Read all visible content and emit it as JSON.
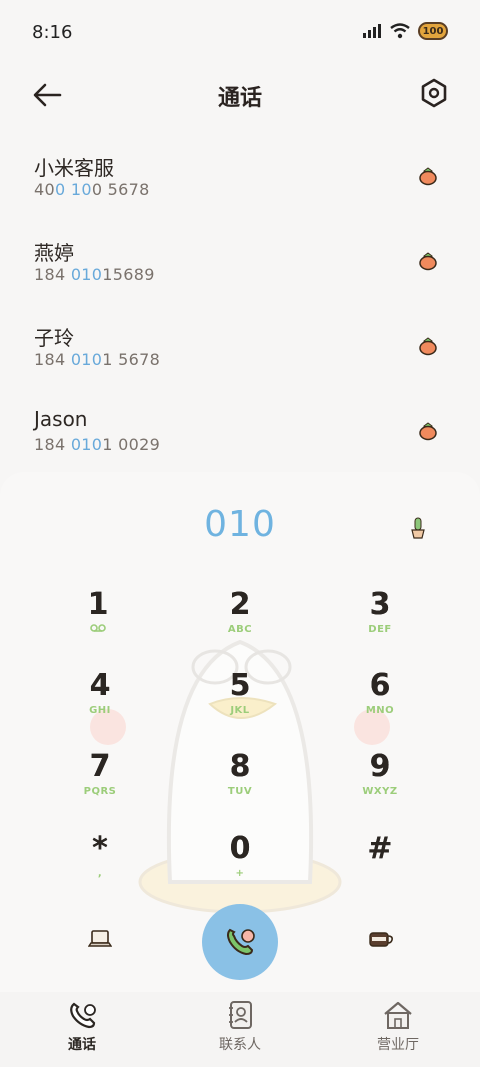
{
  "status": {
    "time": "8:16",
    "battery": "100"
  },
  "header": {
    "title": "通话"
  },
  "contacts": [
    {
      "name": "小米客服",
      "num_a": "40",
      "num_b": "0",
      "num_c": " ",
      "num_d": "10",
      "num_e": "0 5678"
    },
    {
      "name": "燕婷",
      "num_a": "184 ",
      "num_b": "",
      "num_c": "",
      "num_d": "010",
      "num_e": "15689"
    },
    {
      "name": "子玲",
      "num_a": "184 ",
      "num_b": "",
      "num_c": "",
      "num_d": "010",
      "num_e": "1 5678"
    },
    {
      "name": "Jason",
      "num_a": "184 ",
      "num_b": "",
      "num_c": "",
      "num_d": "010",
      "num_e": "1 0029"
    }
  ],
  "dialer": {
    "entry": "010",
    "keys": [
      {
        "digit": "1",
        "sub": ""
      },
      {
        "digit": "2",
        "sub": "ABC"
      },
      {
        "digit": "3",
        "sub": "DEF"
      },
      {
        "digit": "4",
        "sub": "GHI"
      },
      {
        "digit": "5",
        "sub": "JKL"
      },
      {
        "digit": "6",
        "sub": "MNO"
      },
      {
        "digit": "7",
        "sub": "PQRS"
      },
      {
        "digit": "8",
        "sub": "TUV"
      },
      {
        "digit": "9",
        "sub": "WXYZ"
      },
      {
        "digit": "*",
        "sub": ","
      },
      {
        "digit": "0",
        "sub": "+"
      },
      {
        "digit": "#",
        "sub": ""
      }
    ]
  },
  "nav": {
    "calls": "通话",
    "contacts": "联系人",
    "hall": "营业厅"
  },
  "icons": {
    "back": "back-arrow-icon",
    "settings": "hexagon-settings-icon",
    "fruit": "strawberry-icon",
    "voicemail": "voicemail-icon",
    "cactus": "cactus-icon",
    "laptop": "laptop-icon",
    "coffee": "coffee-cup-icon",
    "call": "phone-call-icon"
  },
  "colors": {
    "highlight": "#68a9da",
    "call_button": "#8ac1e6",
    "key_sub": "#9ccd7a"
  }
}
